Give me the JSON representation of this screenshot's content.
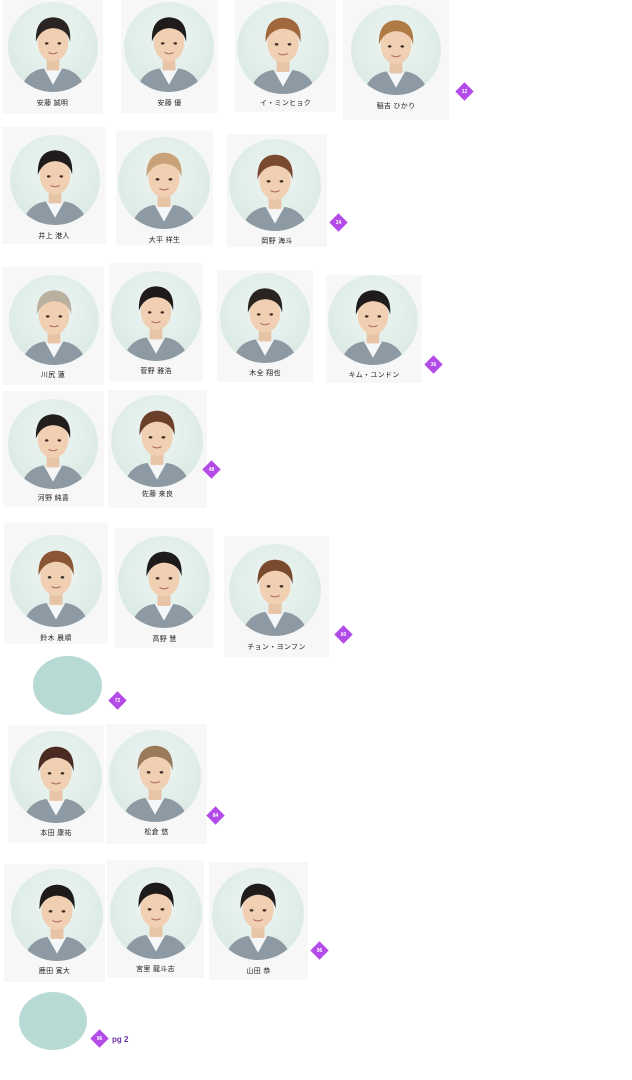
{
  "members": [
    {
      "name": "安藤 誠明",
      "hair": "#2a2522"
    },
    {
      "name": "安藤 優",
      "hair": "#1e1b1a"
    },
    {
      "name": "イ・ミンヒョク",
      "hair": "#a0683c"
    },
    {
      "name": "稲吉 ひかり",
      "hair": "#b07a45"
    },
    {
      "name": "井上 港人",
      "hair": "#1f1c1b"
    },
    {
      "name": "大平 祥生",
      "hair": "#c9a27a"
    },
    {
      "name": "岡野 海斗",
      "hair": "#7a4a30"
    },
    {
      "name": "川尻 蓮",
      "hair": "#b9b0a0"
    },
    {
      "name": "菅野 雅浩",
      "hair": "#1d1a19"
    },
    {
      "name": "木全 翔也",
      "hair": "#2a2420"
    },
    {
      "name": "キム・ユンドン",
      "hair": "#1e1b1a"
    },
    {
      "name": "河野 純喜",
      "hair": "#221e1c"
    },
    {
      "name": "佐藤 来良",
      "hair": "#6b3f2a"
    },
    {
      "name": "鈴木 晨順",
      "hair": "#8a5533"
    },
    {
      "name": "高野 慧",
      "hair": "#1e1b1a"
    },
    {
      "name": "チョン・ヨンフン",
      "hair": "#7a4a2e"
    },
    {
      "name": "本田 康祐",
      "hair": "#4a2a22"
    },
    {
      "name": "松倉 悠",
      "hair": "#9a7a5a"
    },
    {
      "name": "鹿田 寛大",
      "hair": "#1e1b1a"
    },
    {
      "name": "宮里 龍斗志",
      "hair": "#1d1a19"
    },
    {
      "name": "山田 恭",
      "hair": "#1e1b1a"
    }
  ],
  "badges": [
    "12",
    "24",
    "36",
    "48",
    "60",
    "72",
    "84",
    "96",
    "96"
  ],
  "next_page_label": "pg 2",
  "colors": {
    "badge": "#b24be8",
    "placeholder": "#b8dad5",
    "link": "#6a2ea8"
  }
}
